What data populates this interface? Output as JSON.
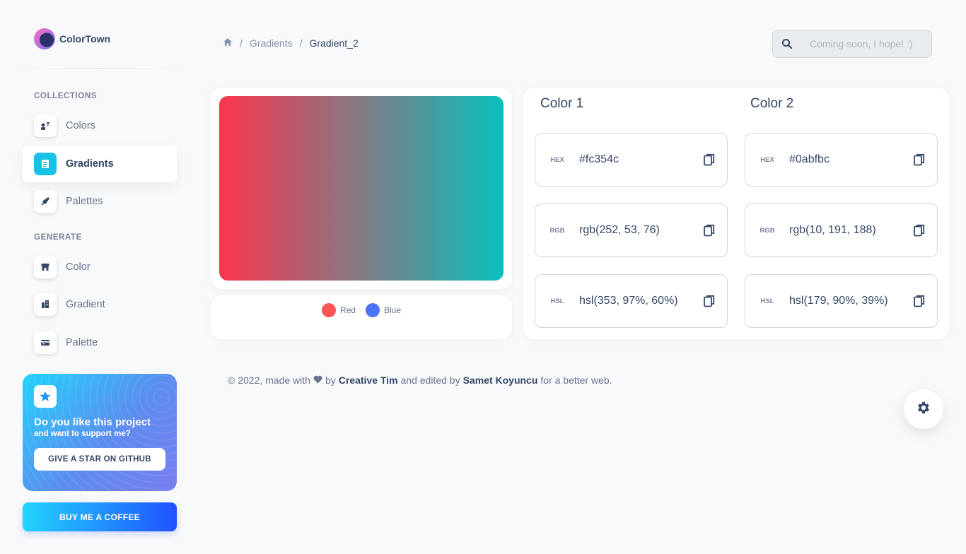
{
  "brand": {
    "name": "ColorTown",
    "logo_icon": "colortown-logo-icon"
  },
  "sidebar": {
    "sections": [
      {
        "title": "COLLECTIONS",
        "items": [
          {
            "label": "Colors",
            "icon": "colors-icon",
            "active": false
          },
          {
            "label": "Gradients",
            "icon": "gradients-icon",
            "active": true
          },
          {
            "label": "Palettes",
            "icon": "palettes-icon",
            "active": false
          }
        ]
      },
      {
        "title": "GENERATE",
        "items": [
          {
            "label": "Color",
            "icon": "store-icon",
            "active": false
          },
          {
            "label": "Gradient",
            "icon": "office-icon",
            "active": false
          },
          {
            "label": "Palette",
            "icon": "credit-card-icon",
            "active": false
          }
        ]
      }
    ],
    "promo": {
      "title": "Do you like this project",
      "subtitle": "and want to support me?",
      "button": "GIVE A STAR ON GITHUB",
      "icon": "star-icon"
    },
    "coffee_button": "BUY ME A COFFEE"
  },
  "breadcrumb": {
    "home_icon": "home-icon",
    "section": "Gradients",
    "current": "Gradient_2",
    "separator": "/"
  },
  "search": {
    "placeholder": "Coming soon, I hope! :)",
    "value": ""
  },
  "gradient": {
    "from": "#fc354c",
    "to": "#0abfbc",
    "legend": [
      {
        "label": "Red",
        "color": "#fc5555"
      },
      {
        "label": "Blue",
        "color": "#4b74f5"
      }
    ]
  },
  "colors": [
    {
      "title": "Color 1",
      "values": [
        {
          "format": "HEX",
          "value": "#fc354c"
        },
        {
          "format": "RGB",
          "value": "rgb(252, 53, 76)"
        },
        {
          "format": "HSL",
          "value": "hsl(353, 97%, 60%)"
        }
      ]
    },
    {
      "title": "Color 2",
      "values": [
        {
          "format": "HEX",
          "value": "#0abfbc"
        },
        {
          "format": "RGB",
          "value": "rgb(10, 191, 188)"
        },
        {
          "format": "HSL",
          "value": "hsl(179, 90%, 39%)"
        }
      ]
    }
  ],
  "footer": {
    "prefix": "© 2022, made with",
    "heart_icon": "heart-icon",
    "by": "by",
    "author": "Creative Tim",
    "edited": "and edited by",
    "editor": "Samet Koyuncu",
    "suffix": "for a better web."
  },
  "settings_icon": "gear-icon"
}
